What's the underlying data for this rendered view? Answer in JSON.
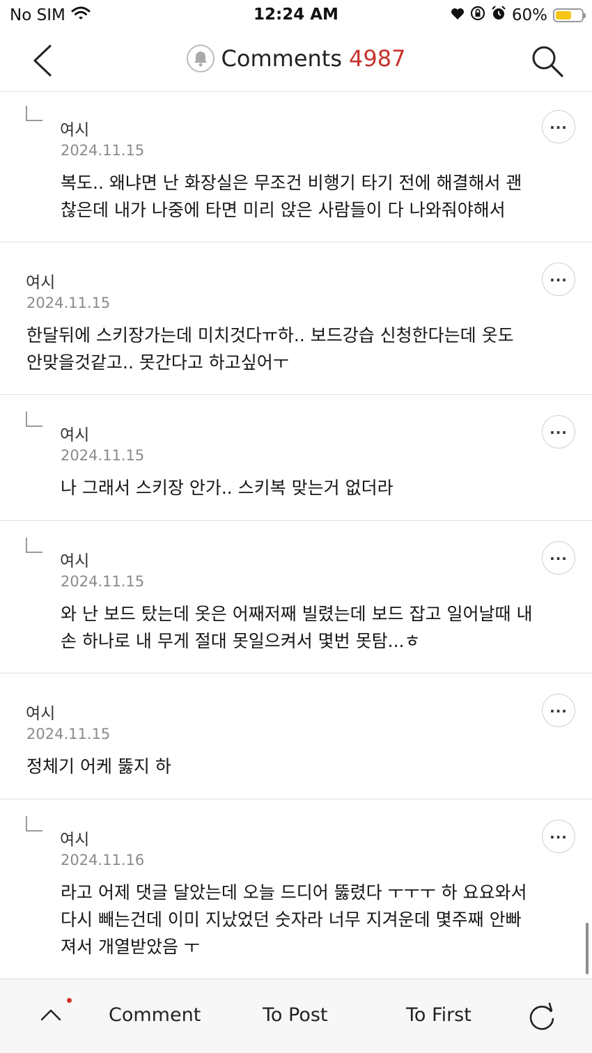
{
  "status_bar": {
    "carrier": "No SIM",
    "time": "12:24 AM",
    "battery_percent": "60%",
    "battery_level": 0.6
  },
  "nav": {
    "title": "Comments",
    "count": "4987"
  },
  "comments": [
    {
      "author": "여시",
      "date": "2024.11.15",
      "lines": [
        "복도.. 왜냐면 난 화장실은 무조건 비행기 타기 전에 해결해서 괜",
        "찮은데 내가 나중에 타면 미리 앉은 사람들이 다 나와줘야해서"
      ],
      "is_reply": true
    },
    {
      "author": "여시",
      "date": "2024.11.15",
      "lines": [
        "한달뒤에 스키장가는데 미치것다ㅠ하.. 보드강습 신청한다는데 옷도",
        "안맞을것같고.. 못간다고 하고싶어ㅜ"
      ],
      "is_reply": false
    },
    {
      "author": "여시",
      "date": "2024.11.15",
      "lines": [
        "나 그래서 스키장 안가.. 스키복 맞는거 없더라"
      ],
      "is_reply": true
    },
    {
      "author": "여시",
      "date": "2024.11.15",
      "lines": [
        "와 난 보드 탔는데 옷은 어째저째 빌렸는데 보드 잡고 일어날때 내",
        "손 하나로 내 무게 절대 못일으켜서 몇번 못탐...ㅎ"
      ],
      "is_reply": true
    },
    {
      "author": "여시",
      "date": "2024.11.15",
      "lines": [
        "정체기 어케 뚫지 하"
      ],
      "is_reply": false
    },
    {
      "author": "여시",
      "date": "2024.11.16",
      "lines": [
        "라고 어제 댓글 달았는데 오늘 드디어 뚫렸다 ㅜㅜㅜ 하 요요와서",
        "다시 빼는건데 이미 지났었던 숫자라 너무 지겨운데 몇주째 안빠",
        "져서 개열받았음 ㅜ"
      ],
      "is_reply": true
    }
  ],
  "bottom_bar": {
    "comment_label": "Comment",
    "to_post_label": "To Post",
    "to_first_label": "To First"
  },
  "colors": {
    "accent": "#c8332d",
    "battery": "#f5c518"
  }
}
